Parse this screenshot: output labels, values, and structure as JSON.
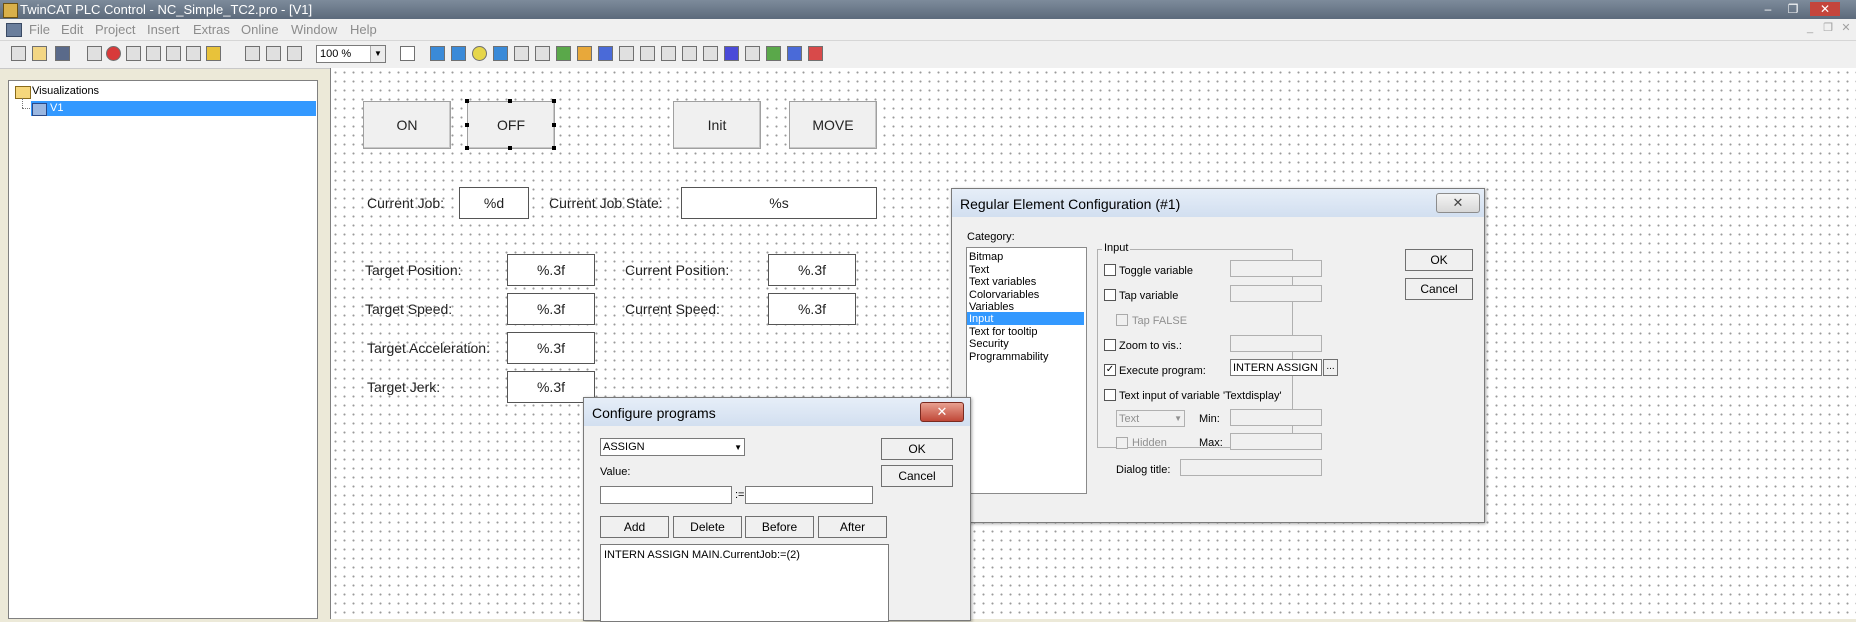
{
  "window": {
    "title": "TwinCAT PLC Control - NC_Simple_TC2.pro - [V1]",
    "min": "–",
    "restore": "❐",
    "close": "✕"
  },
  "menu": [
    "File",
    "Edit",
    "Project",
    "Insert",
    "Extras",
    "Online",
    "Window",
    "Help"
  ],
  "mdi": {
    "min": "_",
    "restore": "❐",
    "close": "✕"
  },
  "toolbar": {
    "zoom": "100 %"
  },
  "tree": {
    "root": "Visualizations",
    "child": "V1"
  },
  "canvas": {
    "buttons": {
      "on": "ON",
      "off": "OFF",
      "init": "Init",
      "move": "MOVE"
    },
    "labels": {
      "current_job": "Current Job:",
      "current_job_state": "Current Job State:",
      "target_position": "Target Position:",
      "current_position": "Current Position:",
      "target_speed": "Target Speed:",
      "current_speed": "Current Speed:",
      "target_acceleration": "Target Acceleration:",
      "target_jerk": "Target Jerk:"
    },
    "boxes": {
      "current_job": "%d",
      "current_job_state": "%s",
      "target_position": "%.3f",
      "current_position": "%.3f",
      "target_speed": "%.3f",
      "current_speed": "%.3f",
      "target_acceleration": "%.3f",
      "target_jerk": "%.3f"
    }
  },
  "regular_dialog": {
    "title": "Regular Element Configuration (#1)",
    "close": "✕",
    "category_label": "Category:",
    "categories": [
      "Bitmap",
      "Text",
      "Text variables",
      "Colorvariables",
      "Variables",
      "Input",
      "Text for tooltip",
      "Security",
      "Programmability"
    ],
    "selected_category": "Input",
    "group_label": "Input",
    "toggle_variable": "Toggle variable",
    "tap_variable": "Tap variable",
    "tap_false": "Tap FALSE",
    "zoom_to_vis": "Zoom to vis.:",
    "execute_program": "Execute program:",
    "execute_program_value": "INTERN ASSIGN M",
    "ellipsis": "...",
    "text_input": "Text input of variable 'Textdisplay'",
    "text_select": "Text",
    "min_label": "Min:",
    "max_label": "Max:",
    "hidden": "Hidden",
    "dialog_title_label": "Dialog title:",
    "ok": "OK",
    "cancel": "Cancel",
    "check_mark": "✓"
  },
  "configure_dialog": {
    "title": "Configure programs",
    "close": "✕",
    "select_value": "ASSIGN",
    "value_label": "Value:",
    "assign_op": ":=",
    "add": "Add",
    "delete": "Delete",
    "before": "Before",
    "after": "After",
    "list_item": "INTERN ASSIGN MAIN.CurrentJob:=(2)",
    "ok": "OK",
    "cancel": "Cancel"
  }
}
